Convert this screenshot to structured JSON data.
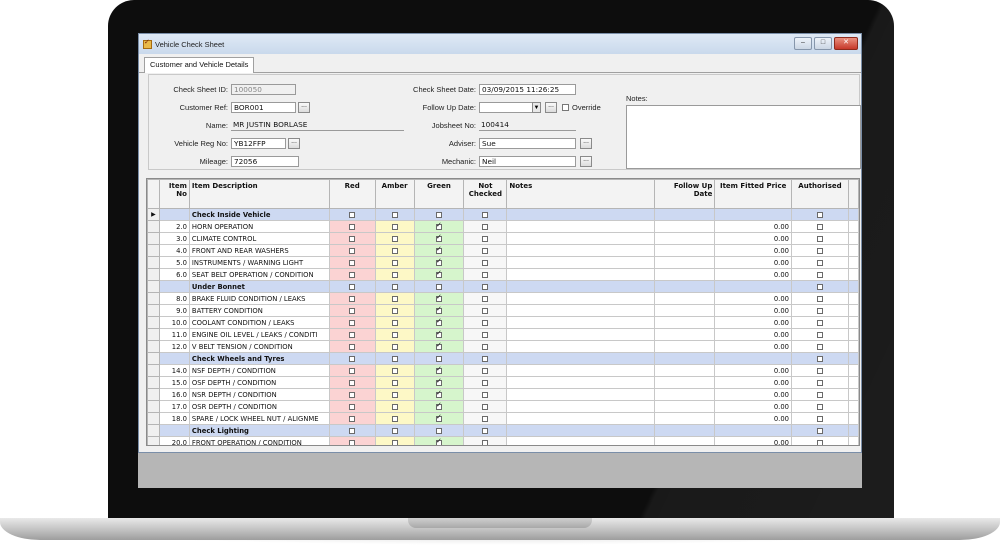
{
  "window": {
    "title": "Vehicle Check Sheet"
  },
  "tabs": [
    {
      "label": "Customer and Vehicle Details"
    }
  ],
  "form": {
    "check_sheet_id": {
      "label": "Check Sheet ID:",
      "value": "100050"
    },
    "customer_ref": {
      "label": "Customer Ref:",
      "value": "BOR001"
    },
    "name": {
      "label": "Name:",
      "value": "MR  JUSTIN BORLASE"
    },
    "vehicle_reg": {
      "label": "Vehicle Reg No:",
      "value": "YB12FFP"
    },
    "mileage": {
      "label": "Mileage:",
      "value": "72056"
    },
    "check_sheet_date": {
      "label": "Check Sheet Date:",
      "value": "03/09/2015 11:26:25"
    },
    "follow_up_date": {
      "label": "Follow Up Date:",
      "value": ""
    },
    "override": {
      "label": "Override",
      "checked": false
    },
    "jobsheet_no": {
      "label": "Jobsheet No:",
      "value": "100414"
    },
    "adviser": {
      "label": "Adviser:",
      "value": "Sue"
    },
    "mechanic": {
      "label": "Mechanic:",
      "value": "Neil"
    },
    "notes": {
      "label": "Notes:",
      "value": ""
    },
    "ellipsis": "..."
  },
  "grid": {
    "columns": {
      "item_no": "Item No",
      "description": "Item Description",
      "red": "Red",
      "amber": "Amber",
      "green": "Green",
      "not_checked": "Not Checked",
      "notes": "Notes",
      "follow_up": "Follow Up Date",
      "price": "Item Fitted Price",
      "authorised": "Authorised"
    },
    "row_pointer": "▶",
    "rows": [
      {
        "type": "category",
        "item_no": "",
        "description": "Check Inside Vehicle",
        "price": "",
        "current": true
      },
      {
        "type": "item",
        "item_no": "2.0",
        "description": "HORN OPERATION",
        "green": true,
        "price": "0.00"
      },
      {
        "type": "item",
        "item_no": "3.0",
        "description": "CLIMATE CONTROL",
        "green": true,
        "price": "0.00"
      },
      {
        "type": "item",
        "item_no": "4.0",
        "description": "FRONT AND REAR WASHERS",
        "green": true,
        "price": "0.00"
      },
      {
        "type": "item",
        "item_no": "5.0",
        "description": "INSTRUMENTS / WARNING LIGHT",
        "green": true,
        "price": "0.00"
      },
      {
        "type": "item",
        "item_no": "6.0",
        "description": "SEAT BELT OPERATION / CONDITION",
        "green": true,
        "price": "0.00"
      },
      {
        "type": "category",
        "item_no": "",
        "description": "Under Bonnet",
        "price": ""
      },
      {
        "type": "item",
        "item_no": "8.0",
        "description": "BRAKE FLUID CONDITION / LEAKS",
        "green": true,
        "price": "0.00"
      },
      {
        "type": "item",
        "item_no": "9.0",
        "description": "BATTERY CONDITION",
        "green": true,
        "price": "0.00"
      },
      {
        "type": "item",
        "item_no": "10.0",
        "description": "COOLANT CONDITION / LEAKS",
        "green": true,
        "price": "0.00"
      },
      {
        "type": "item",
        "item_no": "11.0",
        "description": "ENGINE OIL LEVEL / LEAKS / CONDITI",
        "green": true,
        "price": "0.00"
      },
      {
        "type": "item",
        "item_no": "12.0",
        "description": "V BELT TENSION / CONDITION",
        "green": true,
        "price": "0.00"
      },
      {
        "type": "category",
        "item_no": "",
        "description": "Check Wheels and Tyres",
        "price": ""
      },
      {
        "type": "item",
        "item_no": "14.0",
        "description": "NSF DEPTH / CONDITION",
        "green": true,
        "price": "0.00"
      },
      {
        "type": "item",
        "item_no": "15.0",
        "description": "OSF DEPTH / CONDITION",
        "green": true,
        "price": "0.00"
      },
      {
        "type": "item",
        "item_no": "16.0",
        "description": "NSR DEPTH / CONDITION",
        "green": true,
        "price": "0.00"
      },
      {
        "type": "item",
        "item_no": "17.0",
        "description": "OSR DEPTH / CONDITION",
        "green": true,
        "price": "0.00"
      },
      {
        "type": "item",
        "item_no": "18.0",
        "description": "SPARE / LOCK WHEEL NUT / ALIGNME",
        "green": true,
        "price": "0.00"
      },
      {
        "type": "category",
        "item_no": "",
        "description": "Check Lighting",
        "price": ""
      },
      {
        "type": "item",
        "item_no": "20.0",
        "description": "FRONT OPERATION / CONDITION",
        "green": true,
        "price": "0.00"
      }
    ]
  }
}
